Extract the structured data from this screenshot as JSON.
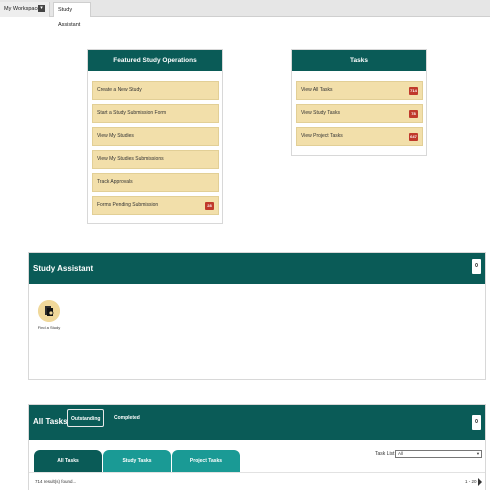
{
  "top_tabs": [
    {
      "label": "My Workspaces"
    },
    {
      "label": "Study Assistant"
    }
  ],
  "featured": {
    "title": "Featured Study Operations",
    "items": [
      {
        "label": "Create a New Study"
      },
      {
        "label": "Start a Study Submission Form"
      },
      {
        "label": "View My Studies"
      },
      {
        "label": "View My Studies Submissions"
      },
      {
        "label": "Track Approvals"
      },
      {
        "label": "Forms Pending Submission",
        "badge": "28"
      }
    ]
  },
  "tasks": {
    "title": "Tasks",
    "items": [
      {
        "label": "View All Tasks",
        "badge": "714"
      },
      {
        "label": "View Study Tasks",
        "badge": "78"
      },
      {
        "label": "View Project Tasks",
        "badge": "647"
      }
    ]
  },
  "study_assistant": {
    "title": "Study Assistant",
    "collapse_label": "0",
    "item_label": "Find a Study"
  },
  "all_tasks": {
    "title": "All Tasks",
    "collapse_label": "0",
    "tabs": [
      {
        "label": "Outstanding"
      },
      {
        "label": "Completed"
      }
    ],
    "task_tabs": [
      {
        "label": "All Tasks"
      },
      {
        "label": "Study Tasks"
      },
      {
        "label": "Project Tasks"
      }
    ],
    "task_list_label": "Task List :",
    "task_list_value": "All",
    "results_text": "714 result(s) found...",
    "pager_text": "1 - 20"
  },
  "colors": {
    "header_teal": "#0a5b57",
    "tab_teal": "#1a9a95",
    "button_tan": "#f2dfaa",
    "badge_red": "#c0392b"
  }
}
